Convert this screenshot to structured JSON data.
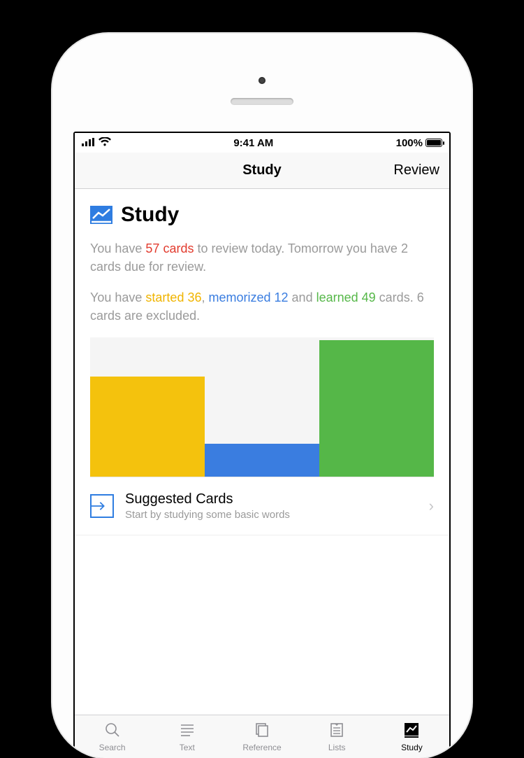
{
  "status": {
    "time": "9:41 AM",
    "battery_pct": "100%"
  },
  "nav": {
    "title": "Study",
    "right": "Review"
  },
  "heading": {
    "title": "Study"
  },
  "summary": {
    "t1": "You have ",
    "red": "57 cards",
    "t2": " to review today. Tomorrow you have 2 cards due for review.",
    "t3": "You have ",
    "yellow": "started 36",
    "comma": ", ",
    "blue": "memorized 12",
    "and": " and ",
    "green": "learned 49",
    "t4": " cards. ",
    "excluded": "6 cards",
    "t5": " are excluded."
  },
  "list": {
    "suggested": {
      "title": "Suggested Cards",
      "subtitle": "Start by studying some basic words"
    }
  },
  "tabs": {
    "search": "Search",
    "text": "Text",
    "reference": "Reference",
    "lists": "Lists",
    "study": "Study"
  },
  "chart_data": {
    "type": "bar",
    "categories": [
      "started",
      "memorized",
      "learned"
    ],
    "values": [
      36,
      12,
      49
    ],
    "colors": [
      "#f4c20d",
      "#3a7de0",
      "#55b748"
    ],
    "title": "",
    "xlabel": "",
    "ylabel": "",
    "ylim": [
      0,
      50
    ]
  }
}
